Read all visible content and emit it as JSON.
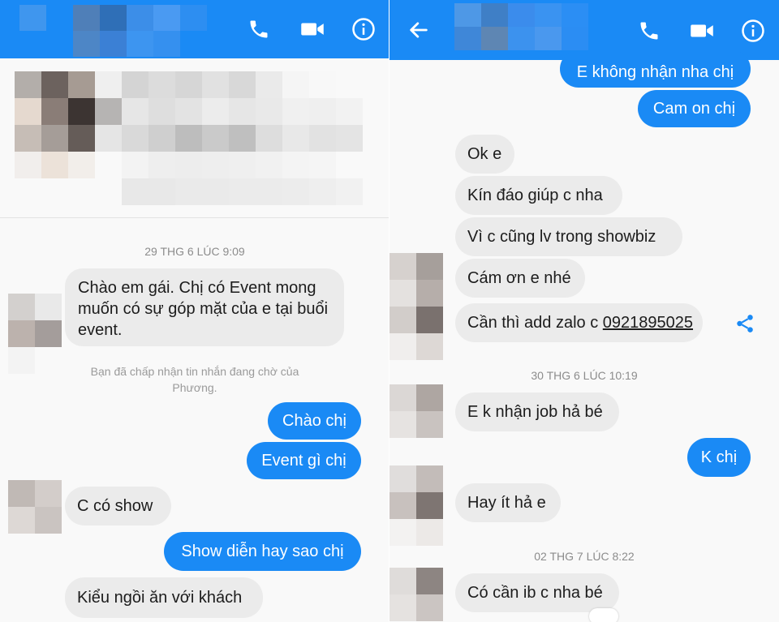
{
  "left": {
    "header": {
      "contact_name_blurred": "",
      "call_icon": "phone-icon",
      "video_icon": "video-camera-icon",
      "info_icon": "info-icon"
    },
    "timestamp": "29 THG 6 LÚC 9:09",
    "notice": "Bạn đã chấp nhận tin nhắn đang chờ của Phương.",
    "messages": [
      {
        "from": "them",
        "text": "Chào em gái. Chị có Event mong muốn có sự góp mặt của e tại buổi event."
      },
      {
        "from": "me",
        "text": "Chào chị"
      },
      {
        "from": "me",
        "text": "Event gì chị"
      },
      {
        "from": "them",
        "text": "C có show"
      },
      {
        "from": "me",
        "text": "Show diễn hay sao chị"
      },
      {
        "from": "them",
        "text": "Kiểu ngồi ăn với khách"
      }
    ]
  },
  "right": {
    "header": {
      "back_icon": "back-arrow-icon",
      "call_icon": "phone-icon",
      "video_icon": "video-camera-icon",
      "info_icon": "info-icon"
    },
    "messages_top": [
      {
        "from": "me",
        "text": "E không nhận nha chị"
      },
      {
        "from": "me",
        "text": "Cam on chị"
      },
      {
        "from": "them",
        "text": "Ok e"
      },
      {
        "from": "them",
        "text": "Kín đáo giúp c nha"
      },
      {
        "from": "them",
        "text": "Vì c cũng lv trong showbiz"
      },
      {
        "from": "them",
        "text": "Cám ơn e nhé"
      }
    ],
    "zalo_message": {
      "prefix": "Cần thì add zalo c ",
      "phone": "0921895025"
    },
    "share_icon": "share-icon",
    "timestamp_1": "30 THG 6 LÚC 10:19",
    "messages_mid": [
      {
        "from": "them",
        "text": "E k nhận job hả bé"
      },
      {
        "from": "me",
        "text": "K chị"
      },
      {
        "from": "them",
        "text": "Hay ít hả e"
      }
    ],
    "timestamp_2": "02 THG 7 LÚC 8:22",
    "messages_bottom": [
      {
        "from": "them",
        "text": "Có cần ib c nha bé"
      }
    ]
  },
  "colors": {
    "accent": "#1a8af5",
    "incoming_bubble": "#ebebeb",
    "background": "#f9f9f9"
  }
}
